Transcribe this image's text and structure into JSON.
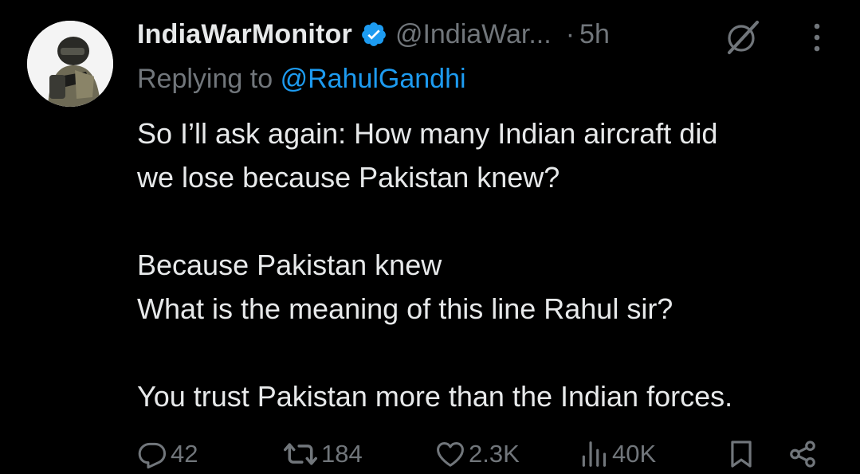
{
  "author": {
    "name": "IndiaWarMonitor",
    "handle": "@IndiaWar...",
    "separator": "·",
    "time": "5h",
    "verified": true
  },
  "reply": {
    "prefix": "Replying to",
    "mention": "@RahulGandhi"
  },
  "body": {
    "line1": "So I’ll ask again: How many Indian aircraft did",
    "line2": "we lose because Pakistan knew?",
    "line3": "Because Pakistan knew",
    "line4": "What is the meaning of this line Rahul sir?",
    "line5": "You trust Pakistan more than the Indian forces."
  },
  "actions": {
    "replies": "42",
    "reposts": "184",
    "likes": "2.3K",
    "views": "40K"
  },
  "icons": {
    "verified": "verified-badge-icon",
    "grok": "grok-icon",
    "more": "more-icon",
    "reply": "reply-icon",
    "repost": "repost-icon",
    "like": "heart-icon",
    "views": "views-icon",
    "bookmark": "bookmark-icon",
    "share": "share-icon"
  },
  "colors": {
    "background": "#000000",
    "text": "#e7e9ea",
    "muted": "#71767b",
    "accent": "#1d9bf0"
  }
}
